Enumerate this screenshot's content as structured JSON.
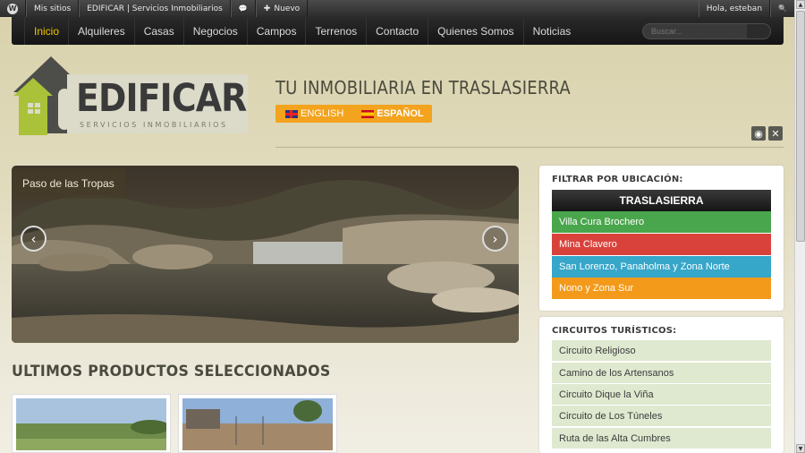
{
  "admin_bar": {
    "wp_logo_glyph": "W",
    "my_sites": "Mis sitios",
    "site_name": "EDIFICAR | Servicios Inmobiliarios",
    "comment_glyph": "💬",
    "new_label": "Nuevo",
    "new_glyph": "✚",
    "greeting": "Hola, esteban",
    "search_glyph": "🔍"
  },
  "nav": {
    "items": [
      "Inicio",
      "Alquileres",
      "Casas",
      "Negocios",
      "Campos",
      "Terrenos",
      "Contacto",
      "Quienes Somos",
      "Noticias"
    ],
    "search_placeholder": "Buscar..."
  },
  "header": {
    "logo_text": "EDIFICAR",
    "logo_subtitle": "SERVICIOS INMOBILIARIOS",
    "tagline": "TU INMOBILIARIA EN TRASLASIERRA",
    "lang_english": "ENGLISH",
    "lang_spanish": "ESPAÑOL",
    "rss_glyph": "◉",
    "x_glyph": "✕"
  },
  "slider": {
    "caption": "Paso de las Tropas",
    "prev_glyph": "‹",
    "next_glyph": "›"
  },
  "products": {
    "title": "ULTIMOS PRODUCTOS SELECCIONADOS"
  },
  "filter_widget": {
    "title": "FILTRAR POR UBICACIÓN:",
    "header": "TRASLASIERRA",
    "items": [
      {
        "label": "Villa Cura Brochero",
        "color": "#4aa64c"
      },
      {
        "label": "Mina Clavero",
        "color": "#d9423a"
      },
      {
        "label": "San Lorenzo, Panaholma y Zona Norte",
        "color": "#36a6c9"
      },
      {
        "label": "Nono y Zona Sur",
        "color": "#f39a1b"
      }
    ]
  },
  "circuits_widget": {
    "title": "CIRCUITOS TURÍSTICOS:",
    "items": [
      "Circuito Religioso",
      "Camino de los Artensanos",
      "Circuito Dique la Viña",
      "Circuito de Los Túneles",
      "Ruta de las Alta Cumbres"
    ]
  }
}
